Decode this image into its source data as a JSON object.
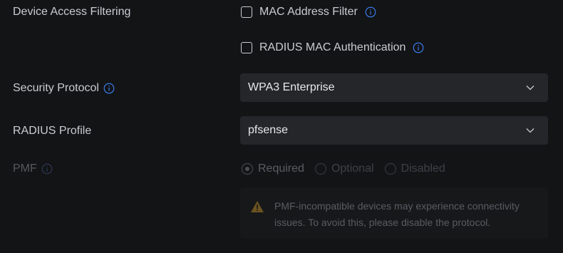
{
  "device_access": {
    "label": "Device Access Filtering",
    "options": [
      {
        "label": "MAC Address Filter",
        "checked": false,
        "has_info": true
      },
      {
        "label": "RADIUS MAC Authentication",
        "checked": false,
        "has_info": true
      }
    ]
  },
  "security_protocol": {
    "label": "Security Protocol",
    "value": "WPA3 Enterprise"
  },
  "radius_profile": {
    "label": "RADIUS Profile",
    "value": "pfsense"
  },
  "pmf": {
    "label": "PMF",
    "disabled": true,
    "options": [
      {
        "label": "Required",
        "selected": true
      },
      {
        "label": "Optional",
        "selected": false
      },
      {
        "label": "Disabled",
        "selected": false
      }
    ],
    "warning_line1": "PMF-incompatible devices may experience connectivity",
    "warning_line2": "issues. To avoid this, please disable the protocol."
  },
  "colors": {
    "background": "#131416",
    "field": "#24262a",
    "info_accent": "#3b82f6",
    "warning": "#6b5320"
  },
  "icons": {
    "info": "info-icon",
    "chevron": "chevron-down-icon",
    "warning": "warning-triangle-icon"
  }
}
